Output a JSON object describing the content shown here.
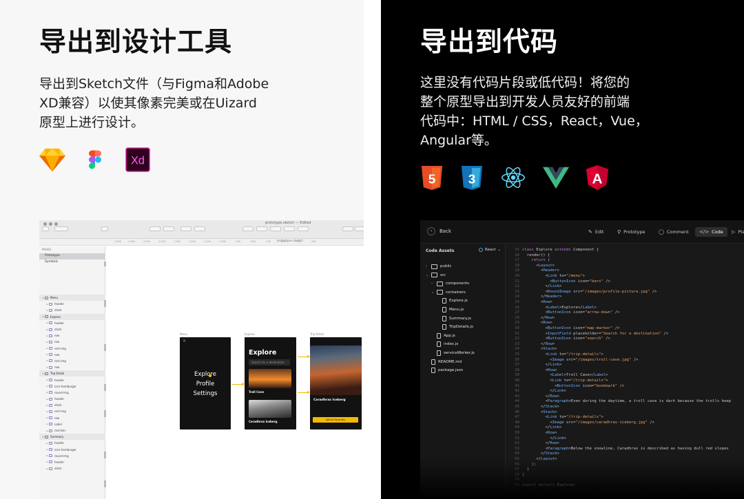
{
  "left": {
    "title": "导出到设计工具",
    "desc": [
      "导出到Sketch文件（与Figma和Adobe",
      "XD兼容）以使其像素完美或在Uizard",
      "原型上进行设计。"
    ],
    "icons": [
      "sketch-icon",
      "figma-icon",
      "adobe-xd-icon"
    ],
    "xd_text": "Xd",
    "sketch_window": {
      "doc_title": "prototype.sketch — Edited",
      "file_name": "prototype.sketch",
      "ruler": [
        "-1'600",
        "-1'600",
        "-1'500",
        "-1'400",
        "-1'300",
        "-1'200",
        "-1'100",
        "-1'000",
        "-900",
        "-800",
        "-700",
        "-600",
        "-500",
        "-400"
      ],
      "pages_label": "PAGES",
      "pages": [
        "Prototype",
        "Symbols"
      ],
      "layers": [
        {
          "t": "Menu",
          "g": true
        },
        {
          "t": "header"
        },
        {
          "t": "stack"
        },
        {
          "t": "Explore",
          "g": true
        },
        {
          "t": "header"
        },
        {
          "t": "stack"
        },
        {
          "t": "row"
        },
        {
          "t": "row"
        },
        {
          "t": "rect-img"
        },
        {
          "t": "row"
        },
        {
          "t": "rect-img"
        },
        {
          "t": "row"
        },
        {
          "t": "Trip Detail",
          "g": true
        },
        {
          "t": "header"
        },
        {
          "t": "icon-hamburger"
        },
        {
          "t": "round-img"
        },
        {
          "t": "header"
        },
        {
          "t": "stack"
        },
        {
          "t": "rect-img"
        },
        {
          "t": "row"
        },
        {
          "t": "Label"
        },
        {
          "t": "rect-btn"
        },
        {
          "t": "Summary",
          "g": true
        },
        {
          "t": "header"
        },
        {
          "t": "icon-hamburger"
        },
        {
          "t": "round-img"
        },
        {
          "t": "header"
        },
        {
          "t": "stack"
        }
      ],
      "artboards": {
        "menu": {
          "label": "Menu",
          "items": [
            "Explore",
            "Profile",
            "Settings"
          ]
        },
        "explore": {
          "label": "Explore",
          "heading": "Explore",
          "search": "Search for a destination",
          "card1": "Troll Cave",
          "card2": "Caradhras Iceberg"
        },
        "trip": {
          "label": "Trip Detail",
          "title": "Caradhras Iceberg",
          "button": "Add to Favorites"
        }
      }
    }
  },
  "right": {
    "title": "导出到代码",
    "desc": [
      "这里没有代码片段或低代码！将您的",
      "整个原型导出到开发人员友好的前端",
      "代码中：HTML / CSS，React，Vue，",
      "Angular等。"
    ],
    "icons": [
      "html5-icon",
      "css3-icon",
      "react-icon",
      "vue-icon",
      "angular-icon"
    ],
    "html5_text": "5",
    "css3_text": "3",
    "angular_text": "A",
    "editor": {
      "back": "Back",
      "tabs": [
        {
          "label": "Edit",
          "icon": "✎"
        },
        {
          "label": "Prototype",
          "icon": "⚲"
        },
        {
          "label": "Comment",
          "icon": "◯"
        },
        {
          "label": "Code",
          "icon": "</>"
        },
        {
          "label": "Pla",
          "icon": "▷"
        }
      ],
      "assets_label": "Code Assets",
      "framework": "React",
      "tree": [
        {
          "name": "public",
          "type": "folder",
          "open": false,
          "depth": 0
        },
        {
          "name": "src",
          "type": "folder",
          "open": true,
          "depth": 0
        },
        {
          "name": "components",
          "type": "folder",
          "open": false,
          "depth": 1
        },
        {
          "name": "containers",
          "type": "folder",
          "open": true,
          "depth": 1
        },
        {
          "name": "Explore.js",
          "type": "file",
          "depth": 2
        },
        {
          "name": "Menu.js",
          "type": "file",
          "depth": 2
        },
        {
          "name": "Summary.js",
          "type": "file",
          "depth": 2
        },
        {
          "name": "TripDetails.js",
          "type": "file",
          "depth": 2
        },
        {
          "name": "App.js",
          "type": "file",
          "depth": 1
        },
        {
          "name": "index.js",
          "type": "file",
          "depth": 1
        },
        {
          "name": "serviceWorker.js",
          "type": "file",
          "depth": 1
        },
        {
          "name": "README.md",
          "type": "file",
          "depth": 0
        },
        {
          "name": "package.json",
          "type": "file",
          "depth": 0
        }
      ],
      "line_start": 15,
      "code": [
        "class Explore extends Component {",
        "  render() {",
        "    return (",
        "      <Layout>",
        "        <Header>",
        "          <Link to=\"/menu\">",
        "            <ButtonIcon icon=\"bars\" />",
        "          </Link>",
        "          <RoundImage src=\"/images/profile-picture.jpg\" />",
        "        </Header>",
        "        <Row>",
        "          <Label>Explore</Label>",
        "          <ButtonIcon icon=\"arrow-down\" />",
        "        </Row>",
        "        <Row>",
        "          <ButtonIcon icon=\"map-marker\" />",
        "          <InputField placeholder=\"Search for a destination\" />",
        "          <ButtonIcon icon=\"search\" />",
        "        </Row>",
        "        <Stack>",
        "          <Link to=\"/trip-details\">",
        "            <Image src=\"/images/troll-cave.jpg\" />",
        "          </Link>",
        "          <Row>",
        "            <Label>Troll Cave</Label>",
        "            <Link to=\"/trip-details\">",
        "              <ButtonIcon icon=\"bookmark\" />",
        "            </Link>",
        "          </Row>",
        "          <Paragraph>Even during the daytime, a troll cave is dark because the trolls keep",
        "        </Stack>",
        "        <Stack>",
        "          <Link to=\"/trip-details\">",
        "            <Image src=\"/images/caradhras-iceberg.jpg\" />",
        "          </Link>",
        "          <Row>",
        "            </Link>",
        "          </Row>",
        "          <Paragraph>Below the snowline, Caradhras is described as having dull red slopes",
        "        </Stack>",
        "      </Layout>",
        "    );",
        "  }",
        "}",
        "",
        "export default Explore;"
      ]
    }
  }
}
